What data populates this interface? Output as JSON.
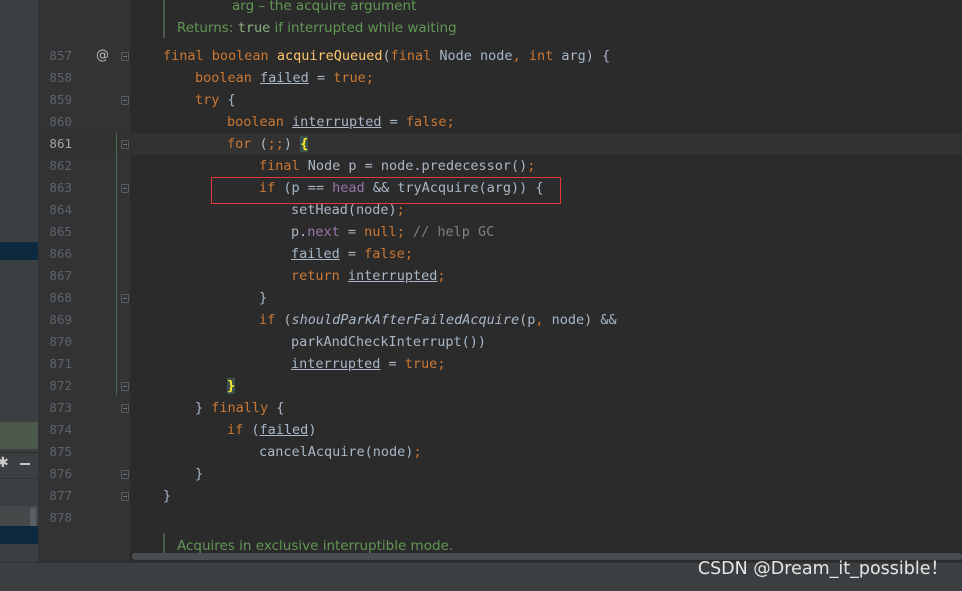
{
  "doc_top": {
    "param_line": "arg – the acquire argument",
    "returns_label": "Returns:",
    "returns_code": "true",
    "returns_text": " if interrupted while waiting"
  },
  "override_marker": "@",
  "gutter": {
    "line_numbers": [
      "857",
      "858",
      "859",
      "860",
      "861",
      "862",
      "863",
      "864",
      "865",
      "866",
      "867",
      "868",
      "869",
      "870",
      "871",
      "872",
      "873",
      "874",
      "875",
      "876",
      "877",
      "878"
    ],
    "current_line": "861"
  },
  "code": {
    "l857": {
      "kw1": "final",
      "kw2": "boolean",
      "name": "acquireQueued",
      "p1": "(",
      "kw3": "final",
      "t1": " Node node",
      "c1": ",",
      "kw4": "int",
      "t2": " arg) {"
    },
    "l858": {
      "kw": "boolean",
      "var": "failed",
      "eq": " = ",
      "val": "true",
      "semi": ";"
    },
    "l859": {
      "kw": "try",
      "rest": " {"
    },
    "l860": {
      "kw": "boolean",
      "var": "interrupted",
      "eq": " = ",
      "val": "false",
      "semi": ";"
    },
    "l861": {
      "kw": "for",
      "paren": " (",
      "semis": ";;",
      "close": ") ",
      "brace": "{"
    },
    "l862": {
      "kw": "final",
      "rest": " Node p = node.predecessor()",
      "semi": ";"
    },
    "l863": {
      "kw": "if",
      "a": " (p == ",
      "fld": "head",
      "b": " && tryAcquire(arg)) {"
    },
    "l864": {
      "call": "setHead(node)",
      "semi": ";"
    },
    "l865": {
      "p": "p.",
      "fld": "next",
      "eq": " = ",
      "val": "null",
      "semi": ";",
      "comment": " // help GC"
    },
    "l866": {
      "var": "failed",
      "eq": " = ",
      "val": "false",
      "semi": ";"
    },
    "l867": {
      "kw": "return",
      "var": "interrupted",
      "semi": ";"
    },
    "l868": {
      "brace": "}"
    },
    "l869": {
      "kw": "if",
      "p": " (",
      "fn": "shouldParkAfterFailedAcquire",
      "args": "(p",
      "c": ",",
      "rest": " node) &&"
    },
    "l870": {
      "call": "parkAndCheckInterrupt())"
    },
    "l871": {
      "var": "interrupted",
      "eq": " = ",
      "val": "true",
      "semi": ";"
    },
    "l872": {
      "brace": "}"
    },
    "l873": {
      "b": "} ",
      "kw": "finally",
      "rest": " {"
    },
    "l874": {
      "kw": "if",
      "p": " (",
      "var": "failed",
      "close": ")"
    },
    "l875": {
      "call": "cancelAcquire(node)",
      "semi": ";"
    },
    "l876": {
      "brace": "}"
    },
    "l877": {
      "brace": "}"
    }
  },
  "doc_bottom": "Acquires in exclusive interruptible mode.",
  "panel_icons": {
    "gear": "gear-icon",
    "minimize": "minimize-icon"
  },
  "watermark": "CSDN @Dream_it_possible！",
  "colors": {
    "highlight_box": "#e0383b",
    "keyword": "#cc7832",
    "method": "#ffc66d",
    "field": "#9876aa",
    "doc": "#629755"
  }
}
